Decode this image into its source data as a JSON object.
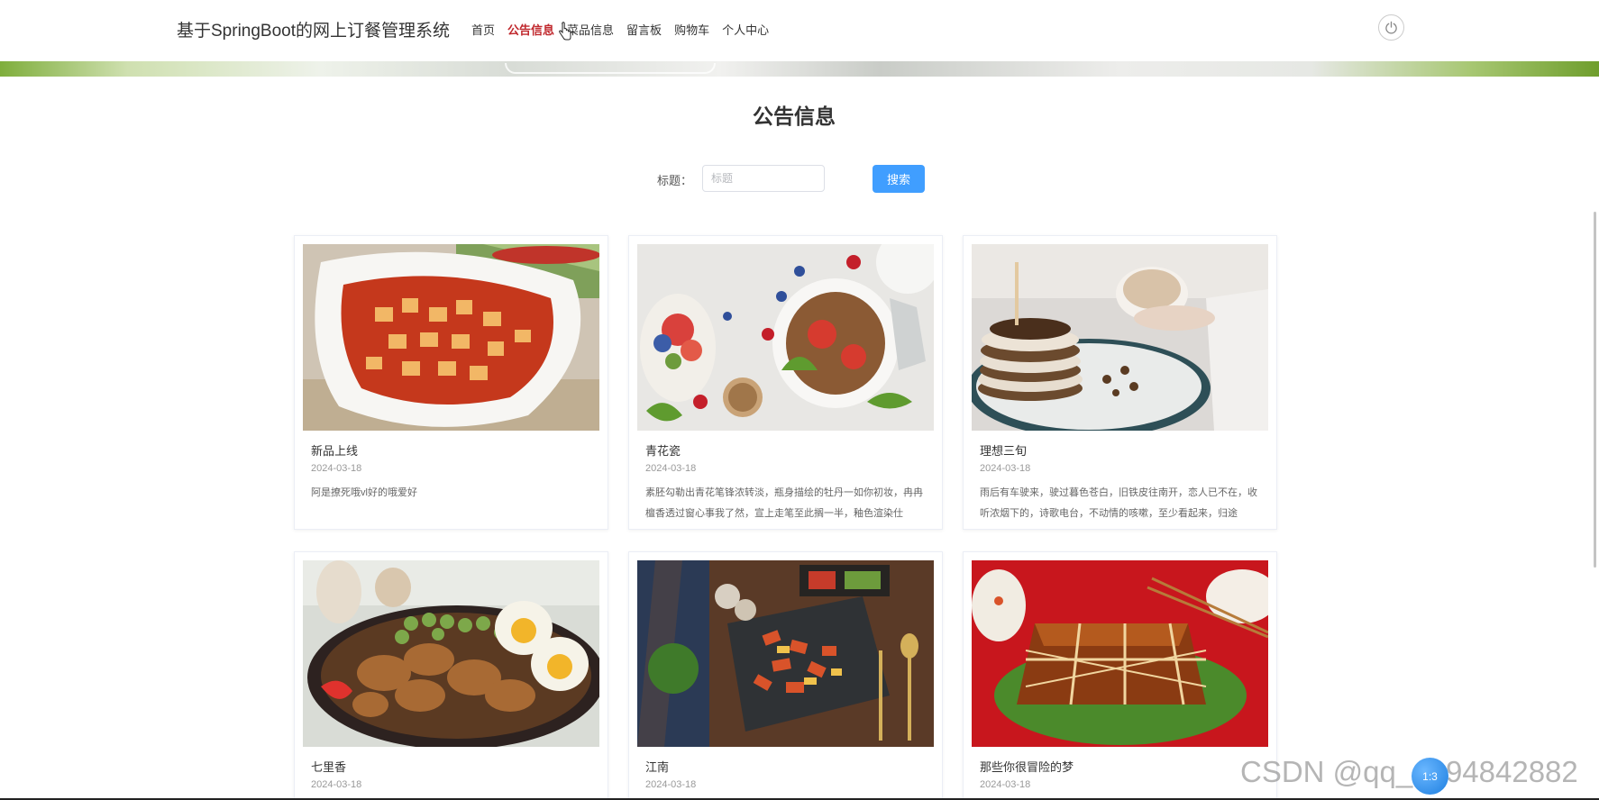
{
  "header": {
    "brand": "基于SpringBoot的网上订餐管理系统",
    "nav": [
      "首页",
      "公告信息",
      "菜品信息",
      "留言板",
      "购物车",
      "个人中心"
    ],
    "active_nav": "公告信息"
  },
  "page": {
    "title": "公告信息"
  },
  "search": {
    "label": "标题：",
    "placeholder": "标题",
    "value": "",
    "button": "搜索"
  },
  "cards": [
    {
      "title": "新品上线",
      "date": "2024-03-18",
      "desc": "阿是撩死哦vl好的哦爱好"
    },
    {
      "title": "青花瓷",
      "date": "2024-03-18",
      "desc": "素胚勾勒出青花笔锋浓转淡，瓶身描绘的牡丹一如你初妆，冉冉檀香透过窗心事我了然，宣上走笔至此搁一半，釉色渲染仕"
    },
    {
      "title": "理想三旬",
      "date": "2024-03-18",
      "desc": "雨后有车驶来，驶过暮色苍白，旧铁皮往南开，恋人已不在，收听浓烟下的，诗歌电台，不动情的咳嗽，至少看起来，归途"
    },
    {
      "title": "七里香",
      "date": "2024-03-18",
      "desc": ""
    },
    {
      "title": "江南",
      "date": "2024-03-18",
      "desc": ""
    },
    {
      "title": "那些你很冒险的梦",
      "date": "2024-03-18",
      "desc": ""
    }
  ],
  "overlay": {
    "watermark": "CSDN @qq_1394842882",
    "float_ball": "1:3"
  },
  "colors": {
    "active_nav": "#c0282d",
    "primary": "#409eff"
  }
}
